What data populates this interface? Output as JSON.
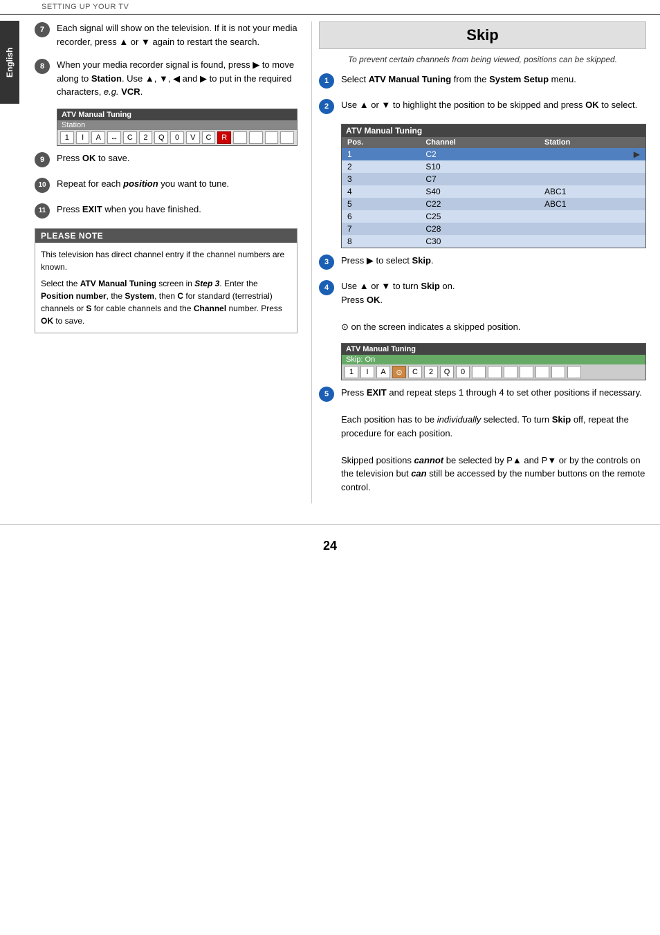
{
  "header": {
    "title": "SETTING UP YOUR TV"
  },
  "side_tab": {
    "label": "English"
  },
  "left_column": {
    "steps": [
      {
        "id": "7",
        "text": "Each signal will show on the television. If it is not your media recorder, press ▲ or ▼ again to restart the search."
      },
      {
        "id": "8",
        "text": "When your media recorder signal is found, press ▶ to move along to <b>Station</b>. Use ▲, ▼, ◀ and ▶ to put in the required characters, <i>e.g.</i> <b>VCR</b>."
      },
      {
        "id": "9",
        "text": "Press <b>OK</b> to save."
      },
      {
        "id": "10",
        "text": "Repeat for each <b><i>position</i></b> you want to tune."
      },
      {
        "id": "11",
        "text": "Press <b>EXIT</b> when you have finished."
      }
    ],
    "atv_box": {
      "header": "ATV Manual Tuning",
      "subheader": "Station",
      "cells": [
        "1",
        "I",
        "A",
        "↔",
        "C",
        "2",
        "Q",
        "0",
        "V",
        "C",
        "R"
      ],
      "highlighted_index": 10
    },
    "note_box": {
      "header": "PLEASE NOTE",
      "lines": [
        "This television has direct channel entry if the channel numbers are known.",
        "Select the ATV Manual Tuning screen in Step 3. Enter the Position number, the System, then C for standard (terrestrial) channels or S for cable channels and the Channel number. Press OK to save."
      ]
    }
  },
  "right_column": {
    "skip_title": "Skip",
    "skip_subtitle": "To prevent certain channels from being viewed, positions can be skipped.",
    "steps": [
      {
        "id": "1",
        "text": "Select <b>ATV Manual Tuning</b> from the <b>System Setup</b> menu."
      },
      {
        "id": "2",
        "text": "Use ▲ or ▼ to highlight the position to be skipped and press <b>OK</b> to select."
      },
      {
        "id": "3",
        "text": "Press ▶ to select <b>Skip</b>."
      },
      {
        "id": "4",
        "text": "Use ▲ or ▼ to turn <b>Skip</b> on.\nPress <b>OK</b>.\n\n⊙ on the screen indicates a skipped position."
      },
      {
        "id": "5",
        "text": "Press <b>EXIT</b> and repeat steps 1 through 4 to set other positions if necessary.\n\nEach position has to be individually selected. To turn <b>Skip</b> off, repeat the procedure for each position.\n\nSkipped positions <b><i>cannot</i></b> be selected by P▲ and P▼ or by the controls on the television but <b><i>can</i></b> still be accessed by the number buttons on the remote control."
      }
    ],
    "atv_table": {
      "header": "ATV Manual Tuning",
      "columns": [
        "Pos.",
        "Channel",
        "Station"
      ],
      "rows": [
        {
          "pos": "1",
          "channel": "C2",
          "station": "",
          "highlight": true
        },
        {
          "pos": "2",
          "channel": "S10",
          "station": ""
        },
        {
          "pos": "3",
          "channel": "C7",
          "station": ""
        },
        {
          "pos": "4",
          "channel": "S40",
          "station": "ABC1"
        },
        {
          "pos": "5",
          "channel": "C22",
          "station": "ABC1"
        },
        {
          "pos": "6",
          "channel": "C25",
          "station": ""
        },
        {
          "pos": "7",
          "channel": "C28",
          "station": ""
        },
        {
          "pos": "8",
          "channel": "C30",
          "station": ""
        }
      ]
    },
    "skip_atv_box": {
      "header": "ATV Manual Tuning",
      "subheader": "Skip: On",
      "cells": [
        "1",
        "I",
        "A",
        "⊙",
        "C",
        "2",
        "Q",
        "0"
      ]
    }
  },
  "page_number": "24"
}
